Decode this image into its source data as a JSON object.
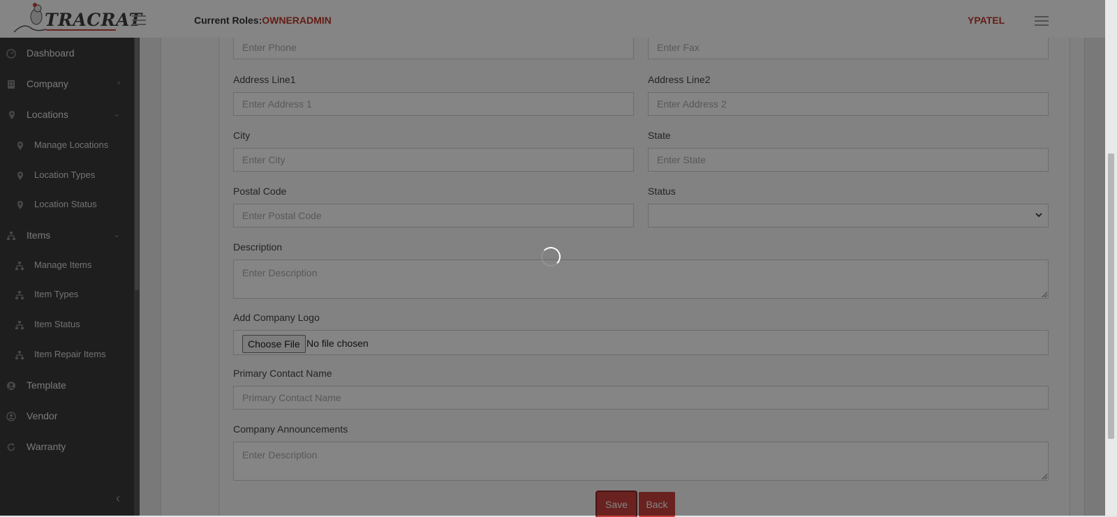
{
  "header": {
    "brand": "TRACRAT",
    "roles_label": "Current Roles:",
    "roles_value": "OWNERADMIN",
    "username": "YPATEL"
  },
  "sidebar": {
    "items": [
      {
        "label": "Dashboard",
        "icon": "dashboard-icon"
      },
      {
        "label": "Company",
        "icon": "building-icon",
        "chevron": "‹"
      },
      {
        "label": "Locations",
        "icon": "map-pin-icon",
        "chevron": "⌄"
      },
      {
        "label": "Manage Locations",
        "icon": "map-pin-icon"
      },
      {
        "label": "Location Types",
        "icon": "map-pin-icon"
      },
      {
        "label": "Location Status",
        "icon": "map-pin-icon"
      },
      {
        "label": "Items",
        "icon": "sitemap-icon",
        "chevron": "⌄"
      },
      {
        "label": "Manage Items",
        "icon": "sitemap-icon"
      },
      {
        "label": "Item Types",
        "icon": "sitemap-icon"
      },
      {
        "label": "Item Status",
        "icon": "sitemap-icon"
      },
      {
        "label": "Item Repair Items",
        "icon": "sitemap-icon"
      },
      {
        "label": "Template",
        "icon": "user-circle-icon"
      },
      {
        "label": "Vendor",
        "icon": "user-icon"
      },
      {
        "label": "Warranty",
        "icon": "refresh-icon"
      }
    ],
    "collapse_glyph": "‹"
  },
  "form": {
    "phone_placeholder": "Enter Phone",
    "fax_placeholder": "Enter Fax",
    "address1_label": "Address Line1",
    "address1_placeholder": "Enter Address 1",
    "address2_label": "Address Line2",
    "address2_placeholder": "Enter Address 2",
    "city_label": "City",
    "city_placeholder": "Enter City",
    "state_label": "State",
    "state_placeholder": "Enter State",
    "postal_label": "Postal Code",
    "postal_placeholder": "Enter Postal Code",
    "status_label": "Status",
    "status_value": "",
    "description_label": "Description",
    "description_placeholder": "Enter Description",
    "logo_label": "Add Company Logo",
    "choose_file": "Choose File",
    "file_status": "No file chosen",
    "contact_label": "Primary Contact Name",
    "contact_placeholder": "Primary Contact Name",
    "announcements_label": "Company Announcements",
    "announcements_placeholder": "Enter Description",
    "save": "Save",
    "back": "Back"
  },
  "colors": {
    "accent": "#c9413c",
    "sidebar_bg": "#3a3a3a"
  }
}
